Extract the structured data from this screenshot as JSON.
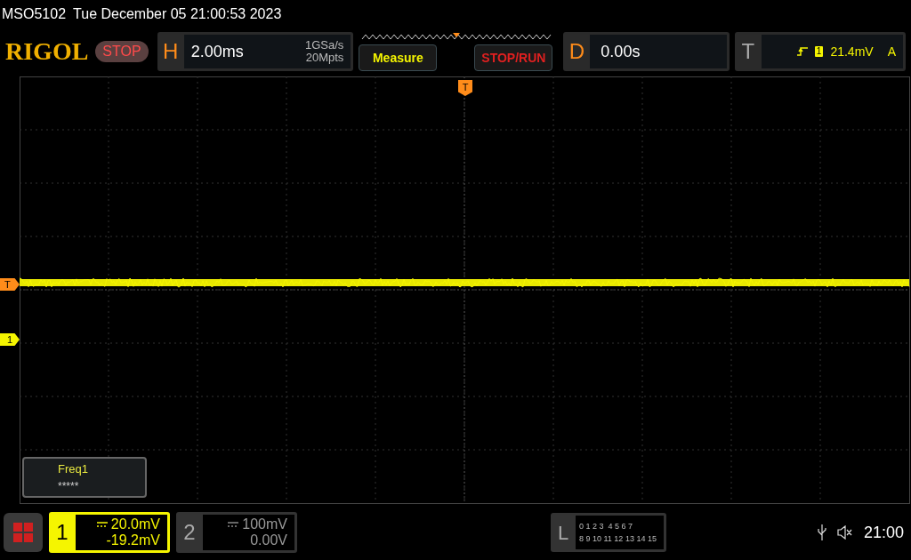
{
  "status_line": {
    "model": "MSO5102",
    "datetime": "Tue December 05 21:00:53 2023"
  },
  "toolbar": {
    "logo": "RIGOL",
    "run_state": "STOP",
    "horizontal": {
      "label": "H",
      "timebase": "2.00ms",
      "sample_rate": "1GSa/s",
      "memory_depth": "20Mpts"
    },
    "buttons": [
      {
        "label": "Measure",
        "kind": "measure"
      },
      {
        "label": "STOP/RUN",
        "kind": "run"
      }
    ],
    "delay": {
      "label": "D",
      "value": "0.00s"
    },
    "trigger": {
      "label": "T",
      "source": "1",
      "level": "21.4mV",
      "mode": "A"
    }
  },
  "screen": {
    "trigger_marker": "T",
    "level_marker": "T",
    "channel_marker": "1",
    "measurement": {
      "name": "Freq1",
      "value": "*****"
    }
  },
  "bottom_bar": {
    "channels": [
      {
        "number": "1",
        "scale": "20.0mV",
        "offset": "-19.2mV",
        "on": true
      },
      {
        "number": "2",
        "scale": "100mV",
        "offset": "0.00V",
        "on": false
      }
    ],
    "logic": {
      "label": "L",
      "rows": [
        "0 1 2 3  4 5 6 7",
        "8 9 10 11 12 13 14 15"
      ]
    },
    "clock": "21:00"
  }
}
